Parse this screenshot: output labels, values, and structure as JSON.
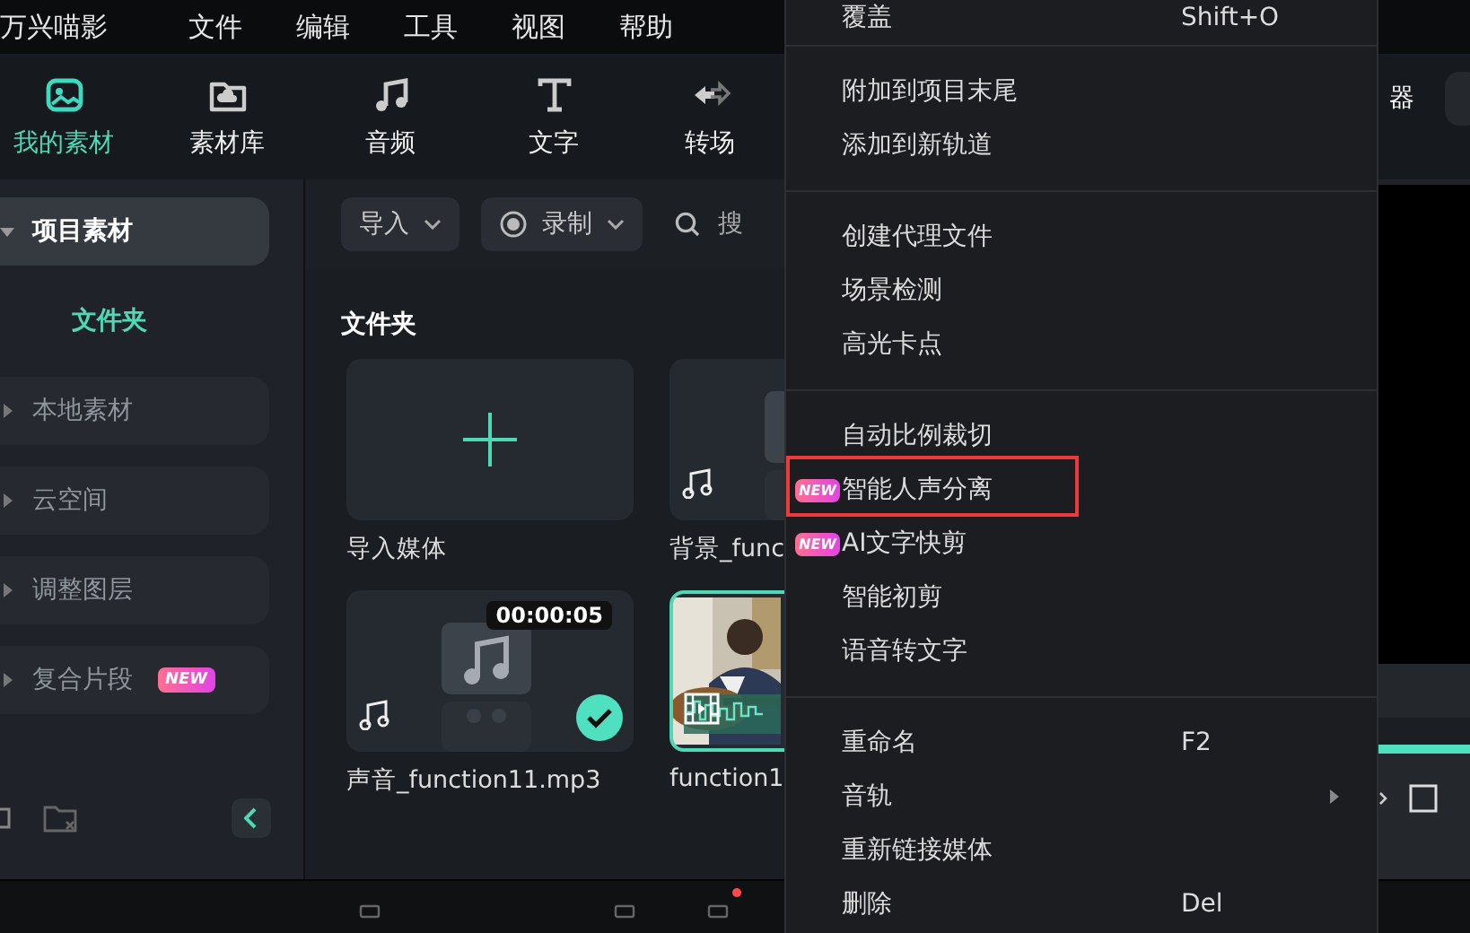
{
  "app": {
    "title": "万兴喵影"
  },
  "menubar": [
    "文件",
    "编辑",
    "工具",
    "视图",
    "帮助"
  ],
  "toolbar": [
    {
      "label": "我的素材",
      "selected": true
    },
    {
      "label": "素材库",
      "selected": false
    },
    {
      "label": "音频",
      "selected": false
    },
    {
      "label": "文字",
      "selected": false
    },
    {
      "label": "转场",
      "selected": false
    }
  ],
  "sidebar": {
    "items": [
      {
        "label": "项目素材",
        "expanded": true,
        "children": [
          {
            "label": "文件夹",
            "selected": true
          }
        ]
      },
      {
        "label": "本地素材",
        "expanded": false
      },
      {
        "label": "云空间",
        "expanded": false
      },
      {
        "label": "调整图层",
        "expanded": false
      },
      {
        "label": "复合片段",
        "expanded": false,
        "badge": "NEW"
      }
    ]
  },
  "media_toolbar": {
    "import_button": "导入",
    "record_button": "录制",
    "search": {
      "placeholder": "搜"
    }
  },
  "section_title": "文件夹",
  "media": [
    {
      "kind": "import",
      "label": "导入媒体",
      "selected": false,
      "checked": false
    },
    {
      "kind": "audio",
      "label": "背景_func",
      "selected": false,
      "checked": false
    },
    {
      "kind": "audio",
      "label": "声音_function11.mp3",
      "duration": "00:00:05",
      "selected": false,
      "checked": true
    },
    {
      "kind": "video",
      "label": "function1",
      "selected": true,
      "checked": false
    }
  ],
  "player": {
    "title": "器",
    "progress": {
      "level": 1
    }
  },
  "context_menu": {
    "groups": [
      [
        {
          "label": "覆盖",
          "shortcut": "Shift+O",
          "highlighted": false
        }
      ],
      [
        {
          "label": "附加到项目末尾",
          "highlighted": false
        },
        {
          "label": "添加到新轨道",
          "highlighted": false
        }
      ],
      [
        {
          "label": "创建代理文件",
          "highlighted": false
        },
        {
          "label": "场景检测",
          "highlighted": false
        },
        {
          "label": "高光卡点",
          "highlighted": false
        }
      ],
      [
        {
          "label": "自动比例裁切",
          "highlighted": false
        },
        {
          "label": "智能人声分离",
          "badge": "NEW",
          "highlighted": true
        },
        {
          "label": "AI文字快剪",
          "badge": "NEW",
          "highlighted": false
        },
        {
          "label": "智能初剪",
          "highlighted": false
        },
        {
          "label": "语音转文字",
          "highlighted": false
        }
      ],
      [
        {
          "label": "重命名",
          "shortcut": "F2",
          "highlighted": false
        },
        {
          "label": "音轨",
          "submenu": true,
          "highlighted": false
        },
        {
          "label": "重新链接媒体",
          "highlighted": false
        },
        {
          "label": "删除",
          "shortcut": "Del",
          "highlighted": false
        }
      ]
    ]
  }
}
